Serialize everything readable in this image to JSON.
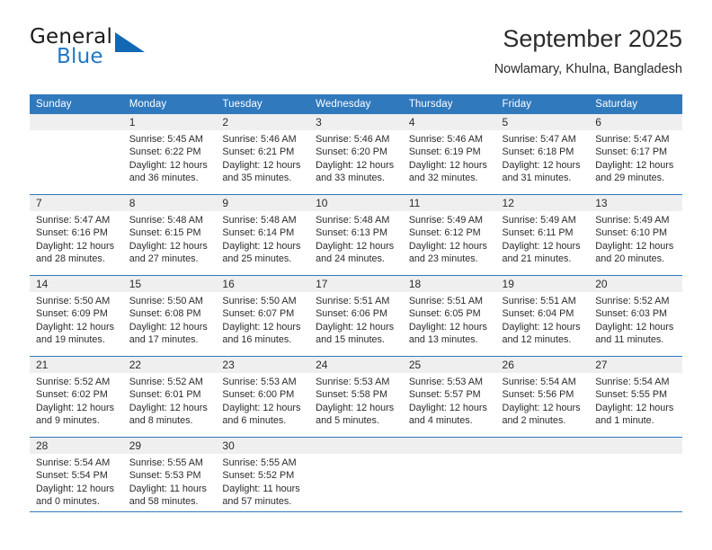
{
  "brand": {
    "name_top": "General",
    "name_bottom": "Blue",
    "color_dark": "#1a1a1a",
    "color_blue": "#2077c4",
    "triangle_color": "#1268b3"
  },
  "header": {
    "title": "September 2025",
    "subtitle": "Nowlamary, Khulna, Bangladesh"
  },
  "theme": {
    "header_bg": "#3179bd",
    "header_text": "#ffffff",
    "daynum_band_bg": "#efefef",
    "body_text": "#2b2b2b"
  },
  "calendar": {
    "weekday_headers": [
      "Sunday",
      "Monday",
      "Tuesday",
      "Wednesday",
      "Thursday",
      "Friday",
      "Saturday"
    ],
    "weeks": [
      [
        {
          "day": "",
          "sunrise": "",
          "sunset": "",
          "daylight_line1": "",
          "daylight_line2": ""
        },
        {
          "day": "1",
          "sunrise": "Sunrise: 5:45 AM",
          "sunset": "Sunset: 6:22 PM",
          "daylight_line1": "Daylight: 12 hours",
          "daylight_line2": "and 36 minutes."
        },
        {
          "day": "2",
          "sunrise": "Sunrise: 5:46 AM",
          "sunset": "Sunset: 6:21 PM",
          "daylight_line1": "Daylight: 12 hours",
          "daylight_line2": "and 35 minutes."
        },
        {
          "day": "3",
          "sunrise": "Sunrise: 5:46 AM",
          "sunset": "Sunset: 6:20 PM",
          "daylight_line1": "Daylight: 12 hours",
          "daylight_line2": "and 33 minutes."
        },
        {
          "day": "4",
          "sunrise": "Sunrise: 5:46 AM",
          "sunset": "Sunset: 6:19 PM",
          "daylight_line1": "Daylight: 12 hours",
          "daylight_line2": "and 32 minutes."
        },
        {
          "day": "5",
          "sunrise": "Sunrise: 5:47 AM",
          "sunset": "Sunset: 6:18 PM",
          "daylight_line1": "Daylight: 12 hours",
          "daylight_line2": "and 31 minutes."
        },
        {
          "day": "6",
          "sunrise": "Sunrise: 5:47 AM",
          "sunset": "Sunset: 6:17 PM",
          "daylight_line1": "Daylight: 12 hours",
          "daylight_line2": "and 29 minutes."
        }
      ],
      [
        {
          "day": "7",
          "sunrise": "Sunrise: 5:47 AM",
          "sunset": "Sunset: 6:16 PM",
          "daylight_line1": "Daylight: 12 hours",
          "daylight_line2": "and 28 minutes."
        },
        {
          "day": "8",
          "sunrise": "Sunrise: 5:48 AM",
          "sunset": "Sunset: 6:15 PM",
          "daylight_line1": "Daylight: 12 hours",
          "daylight_line2": "and 27 minutes."
        },
        {
          "day": "9",
          "sunrise": "Sunrise: 5:48 AM",
          "sunset": "Sunset: 6:14 PM",
          "daylight_line1": "Daylight: 12 hours",
          "daylight_line2": "and 25 minutes."
        },
        {
          "day": "10",
          "sunrise": "Sunrise: 5:48 AM",
          "sunset": "Sunset: 6:13 PM",
          "daylight_line1": "Daylight: 12 hours",
          "daylight_line2": "and 24 minutes."
        },
        {
          "day": "11",
          "sunrise": "Sunrise: 5:49 AM",
          "sunset": "Sunset: 6:12 PM",
          "daylight_line1": "Daylight: 12 hours",
          "daylight_line2": "and 23 minutes."
        },
        {
          "day": "12",
          "sunrise": "Sunrise: 5:49 AM",
          "sunset": "Sunset: 6:11 PM",
          "daylight_line1": "Daylight: 12 hours",
          "daylight_line2": "and 21 minutes."
        },
        {
          "day": "13",
          "sunrise": "Sunrise: 5:49 AM",
          "sunset": "Sunset: 6:10 PM",
          "daylight_line1": "Daylight: 12 hours",
          "daylight_line2": "and 20 minutes."
        }
      ],
      [
        {
          "day": "14",
          "sunrise": "Sunrise: 5:50 AM",
          "sunset": "Sunset: 6:09 PM",
          "daylight_line1": "Daylight: 12 hours",
          "daylight_line2": "and 19 minutes."
        },
        {
          "day": "15",
          "sunrise": "Sunrise: 5:50 AM",
          "sunset": "Sunset: 6:08 PM",
          "daylight_line1": "Daylight: 12 hours",
          "daylight_line2": "and 17 minutes."
        },
        {
          "day": "16",
          "sunrise": "Sunrise: 5:50 AM",
          "sunset": "Sunset: 6:07 PM",
          "daylight_line1": "Daylight: 12 hours",
          "daylight_line2": "and 16 minutes."
        },
        {
          "day": "17",
          "sunrise": "Sunrise: 5:51 AM",
          "sunset": "Sunset: 6:06 PM",
          "daylight_line1": "Daylight: 12 hours",
          "daylight_line2": "and 15 minutes."
        },
        {
          "day": "18",
          "sunrise": "Sunrise: 5:51 AM",
          "sunset": "Sunset: 6:05 PM",
          "daylight_line1": "Daylight: 12 hours",
          "daylight_line2": "and 13 minutes."
        },
        {
          "day": "19",
          "sunrise": "Sunrise: 5:51 AM",
          "sunset": "Sunset: 6:04 PM",
          "daylight_line1": "Daylight: 12 hours",
          "daylight_line2": "and 12 minutes."
        },
        {
          "day": "20",
          "sunrise": "Sunrise: 5:52 AM",
          "sunset": "Sunset: 6:03 PM",
          "daylight_line1": "Daylight: 12 hours",
          "daylight_line2": "and 11 minutes."
        }
      ],
      [
        {
          "day": "21",
          "sunrise": "Sunrise: 5:52 AM",
          "sunset": "Sunset: 6:02 PM",
          "daylight_line1": "Daylight: 12 hours",
          "daylight_line2": "and 9 minutes."
        },
        {
          "day": "22",
          "sunrise": "Sunrise: 5:52 AM",
          "sunset": "Sunset: 6:01 PM",
          "daylight_line1": "Daylight: 12 hours",
          "daylight_line2": "and 8 minutes."
        },
        {
          "day": "23",
          "sunrise": "Sunrise: 5:53 AM",
          "sunset": "Sunset: 6:00 PM",
          "daylight_line1": "Daylight: 12 hours",
          "daylight_line2": "and 6 minutes."
        },
        {
          "day": "24",
          "sunrise": "Sunrise: 5:53 AM",
          "sunset": "Sunset: 5:58 PM",
          "daylight_line1": "Daylight: 12 hours",
          "daylight_line2": "and 5 minutes."
        },
        {
          "day": "25",
          "sunrise": "Sunrise: 5:53 AM",
          "sunset": "Sunset: 5:57 PM",
          "daylight_line1": "Daylight: 12 hours",
          "daylight_line2": "and 4 minutes."
        },
        {
          "day": "26",
          "sunrise": "Sunrise: 5:54 AM",
          "sunset": "Sunset: 5:56 PM",
          "daylight_line1": "Daylight: 12 hours",
          "daylight_line2": "and 2 minutes."
        },
        {
          "day": "27",
          "sunrise": "Sunrise: 5:54 AM",
          "sunset": "Sunset: 5:55 PM",
          "daylight_line1": "Daylight: 12 hours",
          "daylight_line2": "and 1 minute."
        }
      ],
      [
        {
          "day": "28",
          "sunrise": "Sunrise: 5:54 AM",
          "sunset": "Sunset: 5:54 PM",
          "daylight_line1": "Daylight: 12 hours",
          "daylight_line2": "and 0 minutes."
        },
        {
          "day": "29",
          "sunrise": "Sunrise: 5:55 AM",
          "sunset": "Sunset: 5:53 PM",
          "daylight_line1": "Daylight: 11 hours",
          "daylight_line2": "and 58 minutes."
        },
        {
          "day": "30",
          "sunrise": "Sunrise: 5:55 AM",
          "sunset": "Sunset: 5:52 PM",
          "daylight_line1": "Daylight: 11 hours",
          "daylight_line2": "and 57 minutes."
        },
        {
          "day": "",
          "sunrise": "",
          "sunset": "",
          "daylight_line1": "",
          "daylight_line2": ""
        },
        {
          "day": "",
          "sunrise": "",
          "sunset": "",
          "daylight_line1": "",
          "daylight_line2": ""
        },
        {
          "day": "",
          "sunrise": "",
          "sunset": "",
          "daylight_line1": "",
          "daylight_line2": ""
        },
        {
          "day": "",
          "sunrise": "",
          "sunset": "",
          "daylight_line1": "",
          "daylight_line2": ""
        }
      ]
    ]
  }
}
